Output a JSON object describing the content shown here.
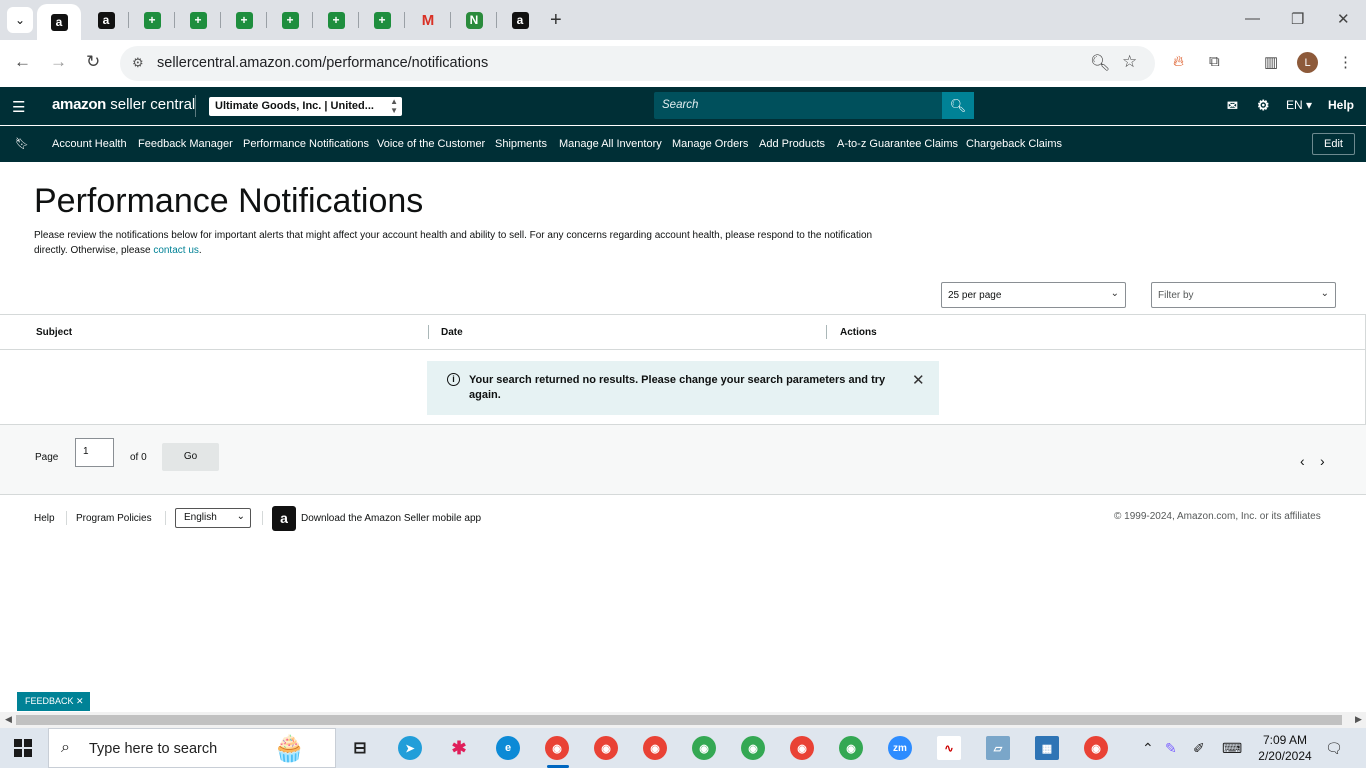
{
  "browser": {
    "url": "sellercentral.amazon.com/performance/notifications",
    "tabs": [
      {
        "icon": "amazon-icon",
        "glyph": "a",
        "type": "amazon",
        "active": true
      },
      {
        "icon": "amazon-icon",
        "glyph": "a",
        "type": "amazon"
      },
      {
        "icon": "sheets-icon",
        "glyph": "+",
        "type": "sheet"
      },
      {
        "icon": "sheets-icon",
        "glyph": "+",
        "type": "sheet"
      },
      {
        "icon": "sheets-icon",
        "glyph": "+",
        "type": "sheet"
      },
      {
        "icon": "sheets-icon",
        "glyph": "+",
        "type": "sheet"
      },
      {
        "icon": "sheets-icon",
        "glyph": "+",
        "type": "sheet"
      },
      {
        "icon": "sheets-icon",
        "glyph": "+",
        "type": "sheet"
      },
      {
        "icon": "gmail-icon",
        "glyph": "M",
        "type": "gmail"
      },
      {
        "icon": "green-app-icon",
        "glyph": "N",
        "type": "green"
      },
      {
        "icon": "amazon-icon",
        "glyph": "a",
        "type": "amazon"
      }
    ],
    "profile_initial": "L"
  },
  "header": {
    "logo_text_1": "amazon",
    "logo_text_2": " seller central",
    "account": "Ultimate Goods, Inc. | United...",
    "search_placeholder": "Search",
    "language": "EN ▾",
    "help": "Help"
  },
  "nav": {
    "items": [
      "Account Health",
      "Feedback Manager",
      "Performance Notifications",
      "Voice of the Customer",
      "Shipments",
      "Manage All Inventory",
      "Manage Orders",
      "Add Products",
      "A-to-z Guarantee Claims",
      "Chargeback Claims"
    ],
    "edit": "Edit"
  },
  "main": {
    "title": "Performance Notifications",
    "intro": "Please review the notifications below for important alerts that might affect your account health and ability to sell. For any concerns regarding account health, please respond to the notification directly. Otherwise, please ",
    "contact_link": "contact us",
    "intro_end": ".",
    "per_page": "25 per page",
    "filter": "Filter by",
    "columns": [
      "Subject",
      "Date",
      "Actions"
    ],
    "alert": "Your search returned no results. Please change your search parameters and try again.",
    "pager": {
      "page_label": "Page",
      "page_value": "1",
      "of_label": "of 0",
      "go": "Go"
    }
  },
  "footer": {
    "help": "Help",
    "policies": "Program Policies",
    "language": "English",
    "app_link": "Download the Amazon Seller mobile app",
    "copyright": "© 1999-2024, Amazon.com, Inc. or its affiliates"
  },
  "feedback": "FEEDBACK ✕",
  "taskbar": {
    "search_placeholder": "Type here to search",
    "time": "7:09 AM",
    "date": "2/20/2024",
    "zoom_label": "zm"
  },
  "colors": {
    "header_bg": "#002f36",
    "accent": "#008296",
    "alert_bg": "#e6f2f3"
  }
}
